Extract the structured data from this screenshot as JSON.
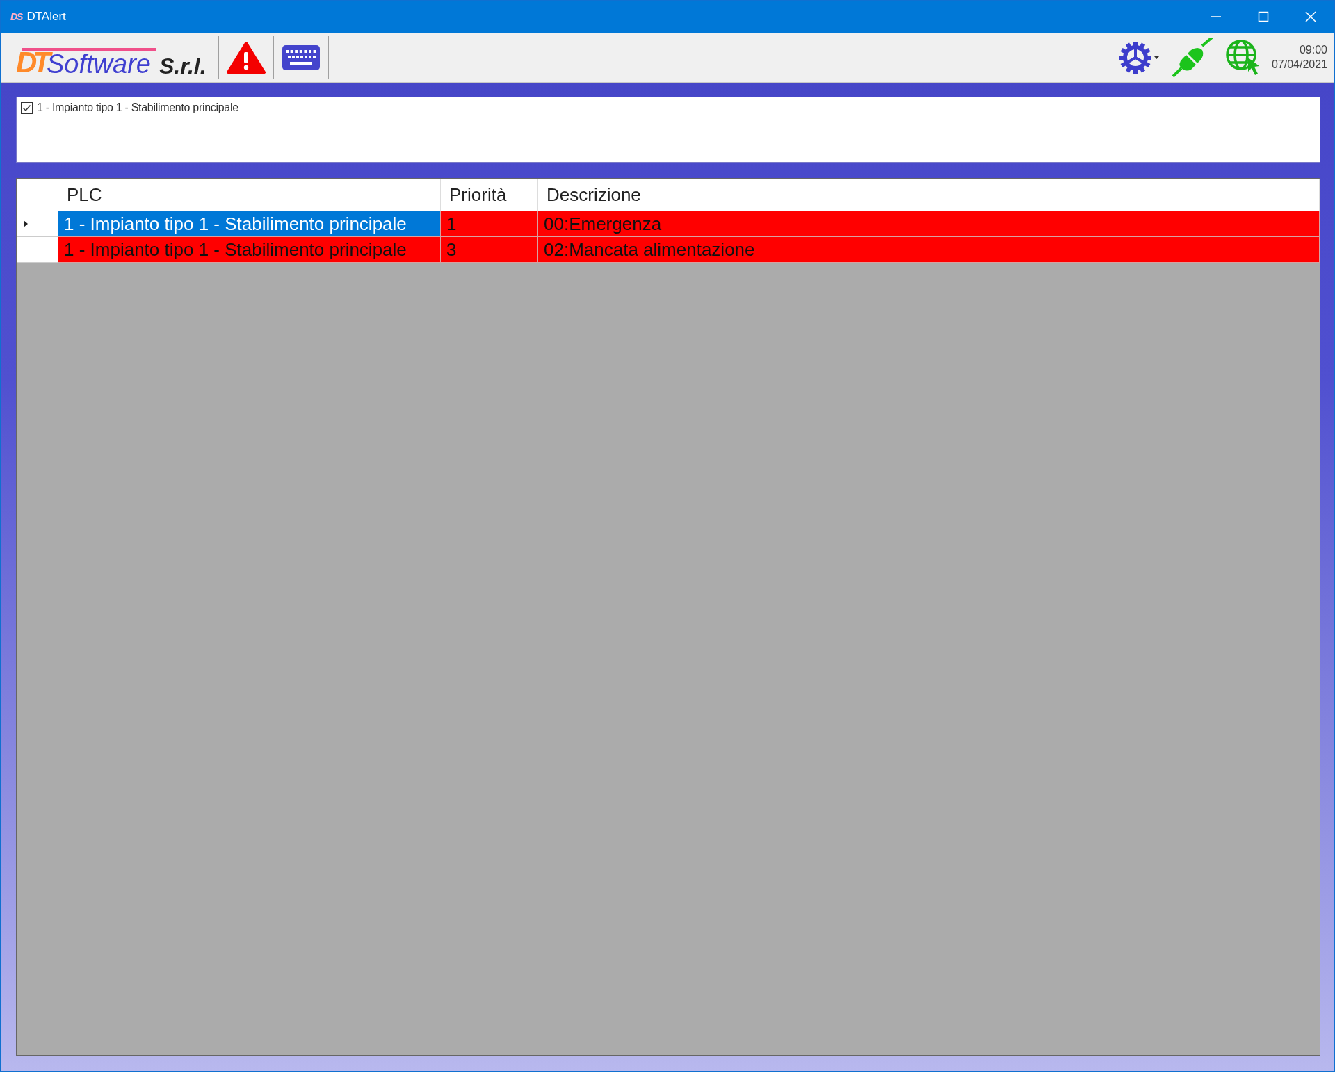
{
  "window": {
    "icon_text": "DS",
    "title": "DTAlert"
  },
  "toolbar": {
    "logo": {
      "initials": "DT",
      "name": "Software",
      "suffix": "S.r.l."
    },
    "time": "09:00",
    "date": "07/04/2021"
  },
  "plants": [
    {
      "label": "1 - Impianto tipo 1 - Stabilimento principale",
      "checked": true
    }
  ],
  "table": {
    "columns": [
      "PLC",
      "Priorità",
      "Descrizione"
    ],
    "rows": [
      {
        "selected": true,
        "cells": [
          "1 - Impianto tipo 1 - Stabilimento principale",
          "1",
          "00:Emergenza"
        ]
      },
      {
        "selected": false,
        "cells": [
          "1 - Impianto tipo 1 - Stabilimento principale",
          "3",
          "02:Mancata alimentazione"
        ]
      }
    ]
  }
}
